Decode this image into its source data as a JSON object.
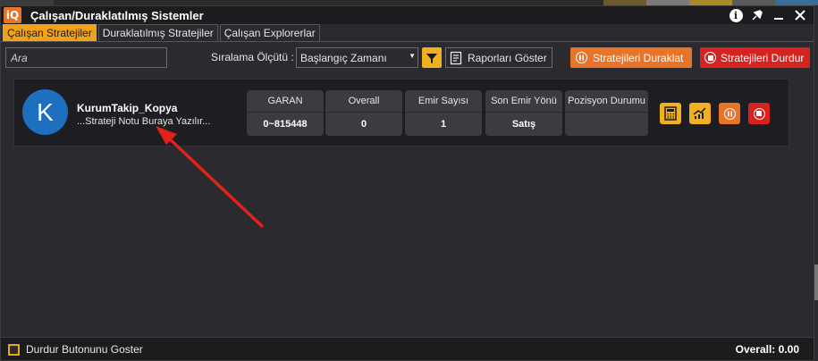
{
  "window": {
    "title": "Çalışan/Duraklatılmış Sistemler",
    "logo_text": "iQ"
  },
  "tabs": [
    {
      "label": "Çalışan Stratejiler",
      "active": true
    },
    {
      "label": "Duraklatılmış Stratejiler",
      "active": false
    },
    {
      "label": "Çalışan Explorerlar",
      "active": false
    }
  ],
  "toolbar": {
    "search_placeholder": "Ara",
    "sort_label": "Sıralama Ölçütü :",
    "sort_value": "Başlangıç Zamanı",
    "report_button": "Raporları Göster",
    "pause_all_button": "Stratejileri Duraklat",
    "stop_all_button": "Stratejileri Durdur"
  },
  "strategy": {
    "avatar_letter": "K",
    "name": "KurumTakip_Kopya",
    "note": "...Strateji Notu Buraya Yazılır...",
    "stats": [
      {
        "header": "GARAN",
        "value": "0~815448"
      },
      {
        "header": "Overall",
        "value": "0"
      },
      {
        "header": "Emir Sayısı",
        "value": "1"
      },
      {
        "header": "Son Emir Yönü",
        "value": "Satış"
      },
      {
        "header": "Pozisyon Durumu",
        "value": ""
      }
    ]
  },
  "statusbar": {
    "checkbox_label": "Durdur Butonunu Goster",
    "overall_text": "Overall:  0.00"
  },
  "colors": {
    "accent": "#f0a21c",
    "pause": "#e8742a",
    "stop": "#d7231f",
    "avatar": "#1f6fc0",
    "annotation_arrow": "#e3201b"
  },
  "icons": [
    "info-icon",
    "pin-icon",
    "minimize-icon",
    "close-icon",
    "filter-icon",
    "report-icon",
    "pause-icon",
    "stop-icon",
    "calculator-icon",
    "chart-icon"
  ]
}
